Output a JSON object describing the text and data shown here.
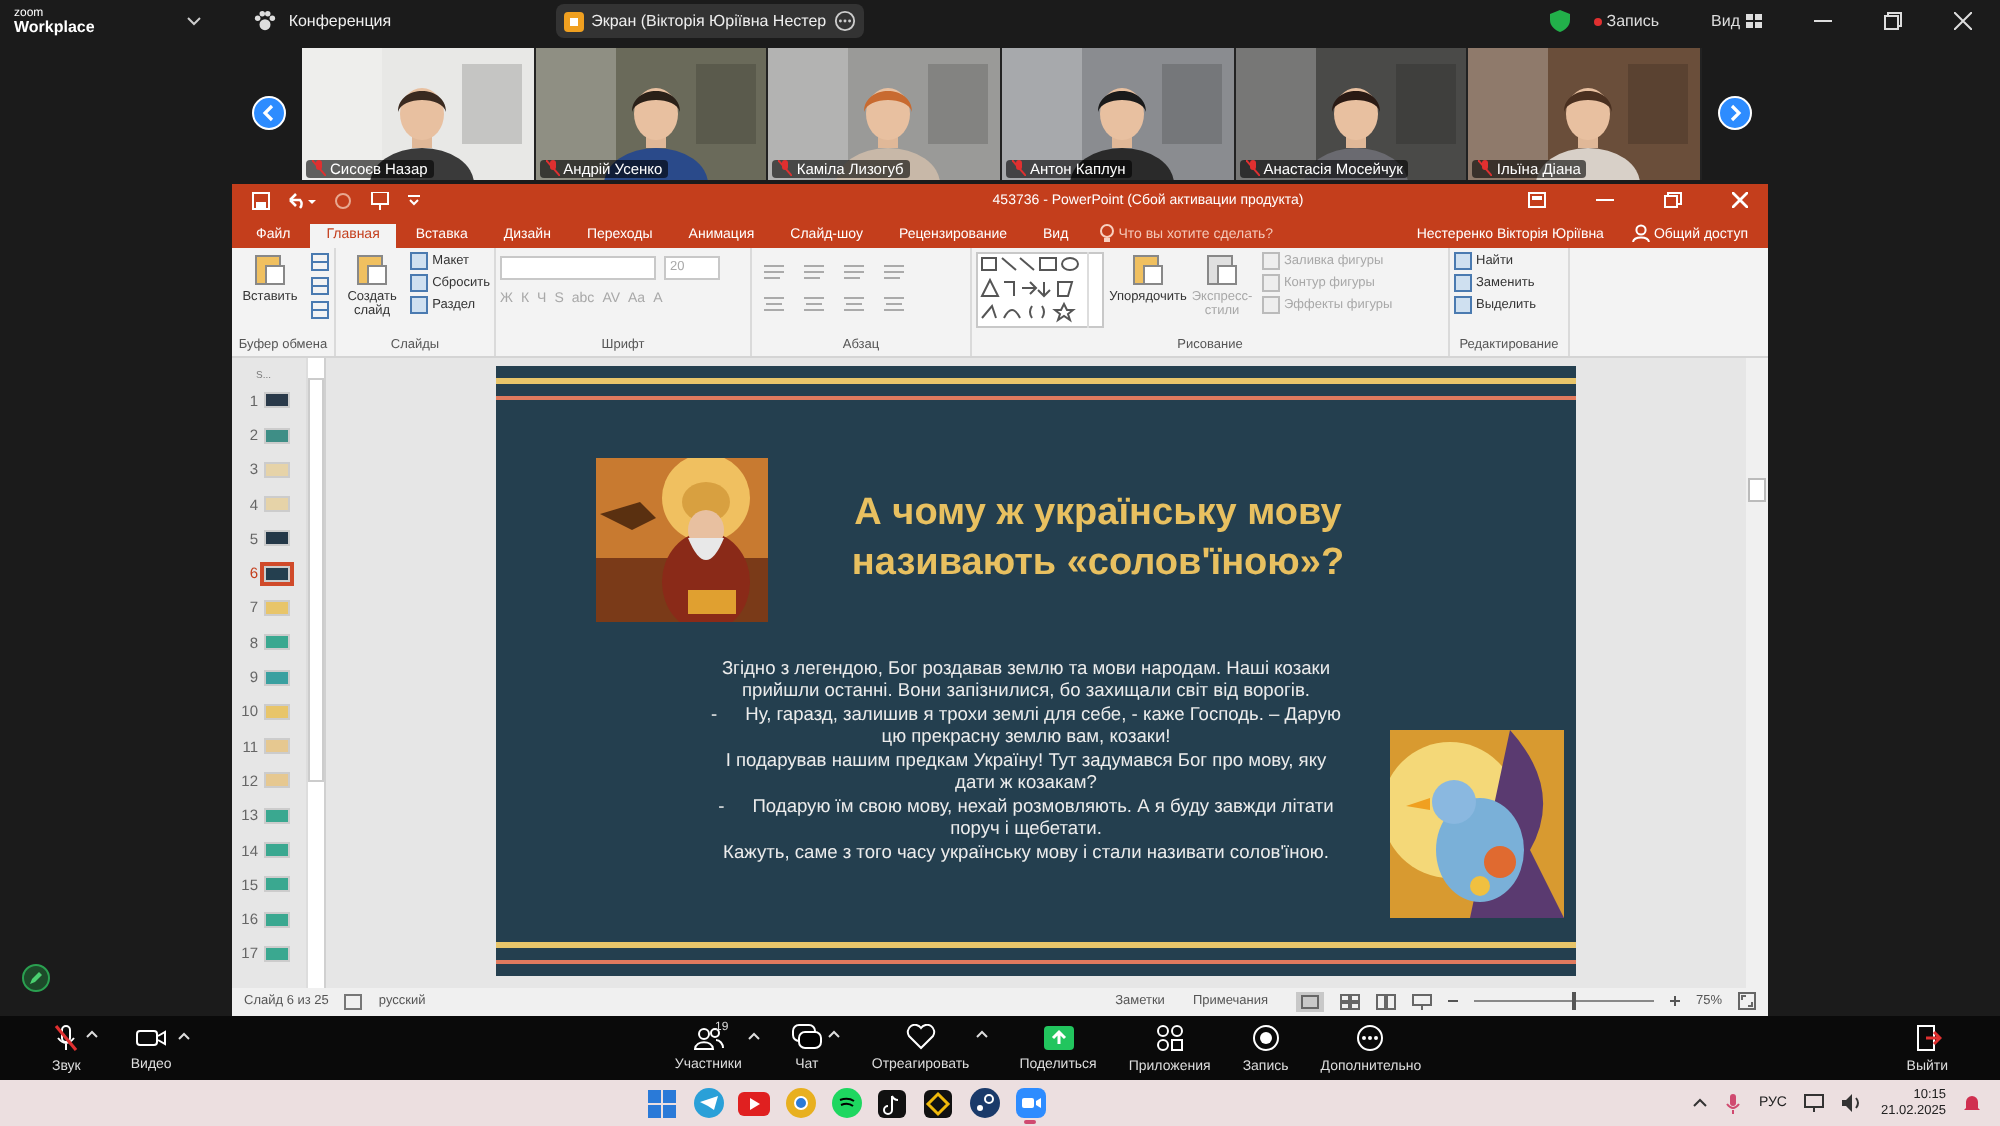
{
  "zoom": {
    "logo_top": "zoom",
    "logo_bottom": "Workplace",
    "meeting": "Конференция",
    "share_pill": "Экран (Вікторія Юріївна Нестер",
    "recording": true,
    "record": "Запись",
    "view": "Вид"
  },
  "participants": [
    {
      "name": "Сисоєв Назар",
      "muted": true
    },
    {
      "name": "Андрій Усенко",
      "muted": true
    },
    {
      "name": "Каміла Лизогуб",
      "muted": true
    },
    {
      "name": "Антон Каплун",
      "muted": true
    },
    {
      "name": "Анастасія Мосейчук",
      "muted": true
    },
    {
      "name": "Ільїна Діана",
      "muted": true
    }
  ],
  "powerpoint": {
    "title": "453736 - PowerPoint (Сбой активации продукта)",
    "tabs": [
      {
        "label": "Файл",
        "selected": false
      },
      {
        "label": "Главная",
        "selected": true
      },
      {
        "label": "Вставка",
        "selected": false
      },
      {
        "label": "Дизайн",
        "selected": false
      },
      {
        "label": "Переходы",
        "selected": false
      },
      {
        "label": "Анимация",
        "selected": false
      },
      {
        "label": "Слайд-шоу",
        "selected": false
      },
      {
        "label": "Рецензирование",
        "selected": false
      },
      {
        "label": "Вид",
        "selected": false
      }
    ],
    "tell_me": "Что вы хотите сделать?",
    "user": "Нестеренко Вікторія Юріївна",
    "share": "Общий доступ",
    "ribbon": [
      {
        "kind": "stack",
        "label": "Буфер обмена",
        "items": [
          {
            "kind": "big",
            "text": "Вставить",
            "disabled": false
          },
          {
            "kind": "icon",
            "disabled": false
          },
          {
            "kind": "icon",
            "disabled": false
          },
          {
            "kind": "icon",
            "disabled": false
          }
        ]
      },
      {
        "kind": "stack",
        "label": "Слайды",
        "items": [
          {
            "kind": "big",
            "text": "Создать слайд",
            "disabled": false
          },
          {
            "kind": "small",
            "text": "Макет",
            "disabled": false
          },
          {
            "kind": "small",
            "text": "Сбросить",
            "disabled": false
          },
          {
            "kind": "small",
            "text": "Раздел",
            "disabled": false
          }
        ]
      },
      {
        "kind": "font",
        "label": "Шрифт",
        "font_size": "20",
        "glyphs": [
          "Ж",
          "К",
          "Ч",
          "S",
          "abc",
          "AV",
          "Aa",
          "A"
        ],
        "disabled": true
      },
      {
        "kind": "paragraph",
        "label": "Абзац"
      },
      {
        "kind": "drawing",
        "label": "Рисование",
        "items": [
          {
            "kind": "big",
            "text": "Упорядочить",
            "disabled": false
          },
          {
            "kind": "big",
            "text": "Экспресс-стили",
            "disabled": true
          },
          {
            "kind": "small",
            "text": "Заливка фигуры",
            "disabled": true
          },
          {
            "kind": "small",
            "text": "Контур фигуры",
            "disabled": true
          },
          {
            "kind": "small",
            "text": "Эффекты фигуры",
            "disabled": true
          }
        ]
      },
      {
        "kind": "stack",
        "label": "Редактирование",
        "items": [
          {
            "kind": "small",
            "text": "Найти",
            "disabled": false
          },
          {
            "kind": "small",
            "text": "Заменить",
            "disabled": false
          },
          {
            "kind": "small",
            "text": "Выделить",
            "disabled": false
          }
        ]
      }
    ],
    "thumbs_header": "S...",
    "thumbnails": [
      {
        "number": "1",
        "color": "#2a3a4a",
        "selected": false
      },
      {
        "number": "2",
        "color": "#3e8e86",
        "selected": false
      },
      {
        "number": "3",
        "color": "#e6d3a8",
        "selected": false
      },
      {
        "number": "4",
        "color": "#e6d3a8",
        "selected": false
      },
      {
        "number": "5",
        "color": "#243848",
        "selected": false
      },
      {
        "number": "6",
        "color": "#243f4f",
        "selected": true
      },
      {
        "number": "7",
        "color": "#e8c56a",
        "selected": false
      },
      {
        "number": "8",
        "color": "#3aa890",
        "selected": false
      },
      {
        "number": "9",
        "color": "#3aa0a0",
        "selected": false
      },
      {
        "number": "10",
        "color": "#e8c56a",
        "selected": false
      },
      {
        "number": "11",
        "color": "#e6c890",
        "selected": false
      },
      {
        "number": "12",
        "color": "#e6c890",
        "selected": false
      },
      {
        "number": "13",
        "color": "#3aa890",
        "selected": false
      },
      {
        "number": "14",
        "color": "#3aa890",
        "selected": false
      },
      {
        "number": "15",
        "color": "#3aa890",
        "selected": false
      },
      {
        "number": "16",
        "color": "#3aa890",
        "selected": false
      },
      {
        "number": "17",
        "color": "#3aa890",
        "selected": false
      }
    ],
    "slide": {
      "title": [
        "А чому ж українську мову",
        "називають «солов'їною»?"
      ],
      "body": [
        {
          "text": "Згідно з легендою, Бог роздавав землю та мови народам. Наші козаки"
        },
        {
          "text": "прийшли останні. Вони запізнилися, бо захищали світ від ворогів."
        },
        {
          "bullet": "-",
          "text": "Ну, гаразд, залишив я трохи землі для себе, - каже Господь. – Дарую"
        },
        {
          "text": "цю прекрасну землю вам, козаки!"
        },
        {
          "text": "І подарував нашим предкам Україну! Тут задумався Бог про мову, яку"
        },
        {
          "text": "дати ж козакам?"
        },
        {
          "bullet": "-",
          "text": "Подарую їм свою мову, нехай розмовляють. А я буду завжди літати"
        },
        {
          "text": "поруч і щебетати."
        },
        {
          "text": "Кажуть, саме з того часу українську мову і стали називати солов'їною."
        }
      ]
    },
    "status": {
      "slide": "Слайд 6 из 25",
      "language": "русский",
      "notes": "Заметки",
      "comments": "Примечания",
      "zoom": "75%",
      "level": 0.55
    }
  },
  "toolbar": [
    {
      "kind": "audio",
      "label": "Звук",
      "muted": true,
      "menu": true
    },
    {
      "kind": "video",
      "label": "Видео",
      "menu": true
    },
    {
      "kind": "participants",
      "label": "Участники",
      "count": "19",
      "menu": true
    },
    {
      "kind": "chat",
      "label": "Чат",
      "menu": true
    },
    {
      "kind": "react",
      "label": "Отреагировать",
      "menu": true
    },
    {
      "kind": "share",
      "label": "Поделиться",
      "menu": false
    },
    {
      "kind": "apps",
      "label": "Приложения",
      "menu": false
    },
    {
      "kind": "record",
      "label": "Запись",
      "menu": false
    },
    {
      "kind": "more",
      "label": "Дополнительно",
      "menu": false
    },
    {
      "kind": "leave",
      "label": "Выйти",
      "menu": false
    }
  ],
  "taskbar": {
    "apps": [
      {
        "kind": "start",
        "selected": false
      },
      {
        "kind": "telegram",
        "selected": false
      },
      {
        "kind": "youtube",
        "selected": false
      },
      {
        "kind": "chrome",
        "selected": false
      },
      {
        "kind": "spotify",
        "selected": false
      },
      {
        "kind": "tiktok",
        "selected": false
      },
      {
        "kind": "binance",
        "selected": false
      },
      {
        "kind": "steam",
        "selected": false
      },
      {
        "kind": "zoom",
        "selected": true
      }
    ],
    "language": "РУС",
    "time": "10:15",
    "date": "21.02.2025"
  }
}
